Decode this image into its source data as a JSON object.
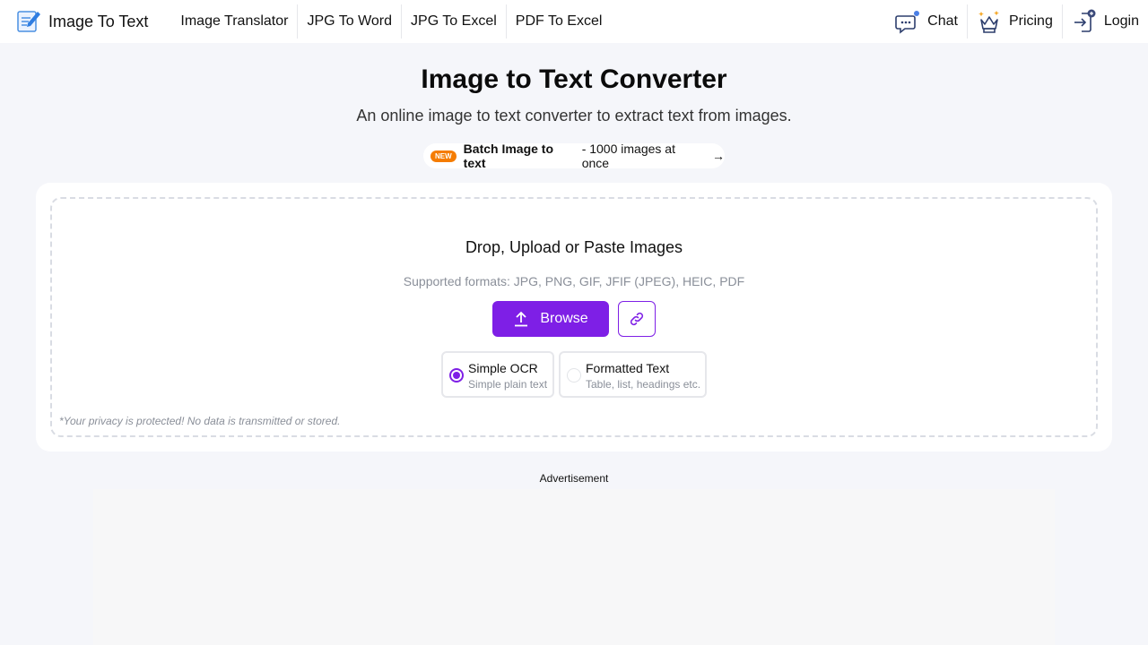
{
  "header": {
    "logo_text": "Image To Text",
    "nav": [
      "Image Translator",
      "JPG To Word",
      "JPG To Excel",
      "PDF To Excel"
    ],
    "chat_label": "Chat",
    "pricing_label": "Pricing",
    "login_label": "Login"
  },
  "hero": {
    "title": "Image to Text Converter",
    "subtitle": "An online image to text converter to extract text from images.",
    "batch_badge": "NEW",
    "batch_bold": "Batch Image to text",
    "batch_rest": "- 1000 images at once",
    "batch_arrow": "→"
  },
  "upload": {
    "title": "Drop, Upload or Paste Images",
    "formats": "Supported formats: JPG, PNG, GIF, JFIF (JPEG), HEIC, PDF",
    "browse_label": "Browse",
    "options": [
      {
        "title": "Simple OCR",
        "subtitle": "Simple plain text",
        "selected": true
      },
      {
        "title": "Formatted Text",
        "subtitle": "Table, list, headings etc.",
        "selected": false
      }
    ],
    "privacy": "*Your privacy is protected! No data is transmitted or stored."
  },
  "ad": {
    "label": "Advertisement"
  },
  "colors": {
    "accent": "#7e1fe6",
    "badge": "#f57c00",
    "background": "#f5f6fa"
  }
}
